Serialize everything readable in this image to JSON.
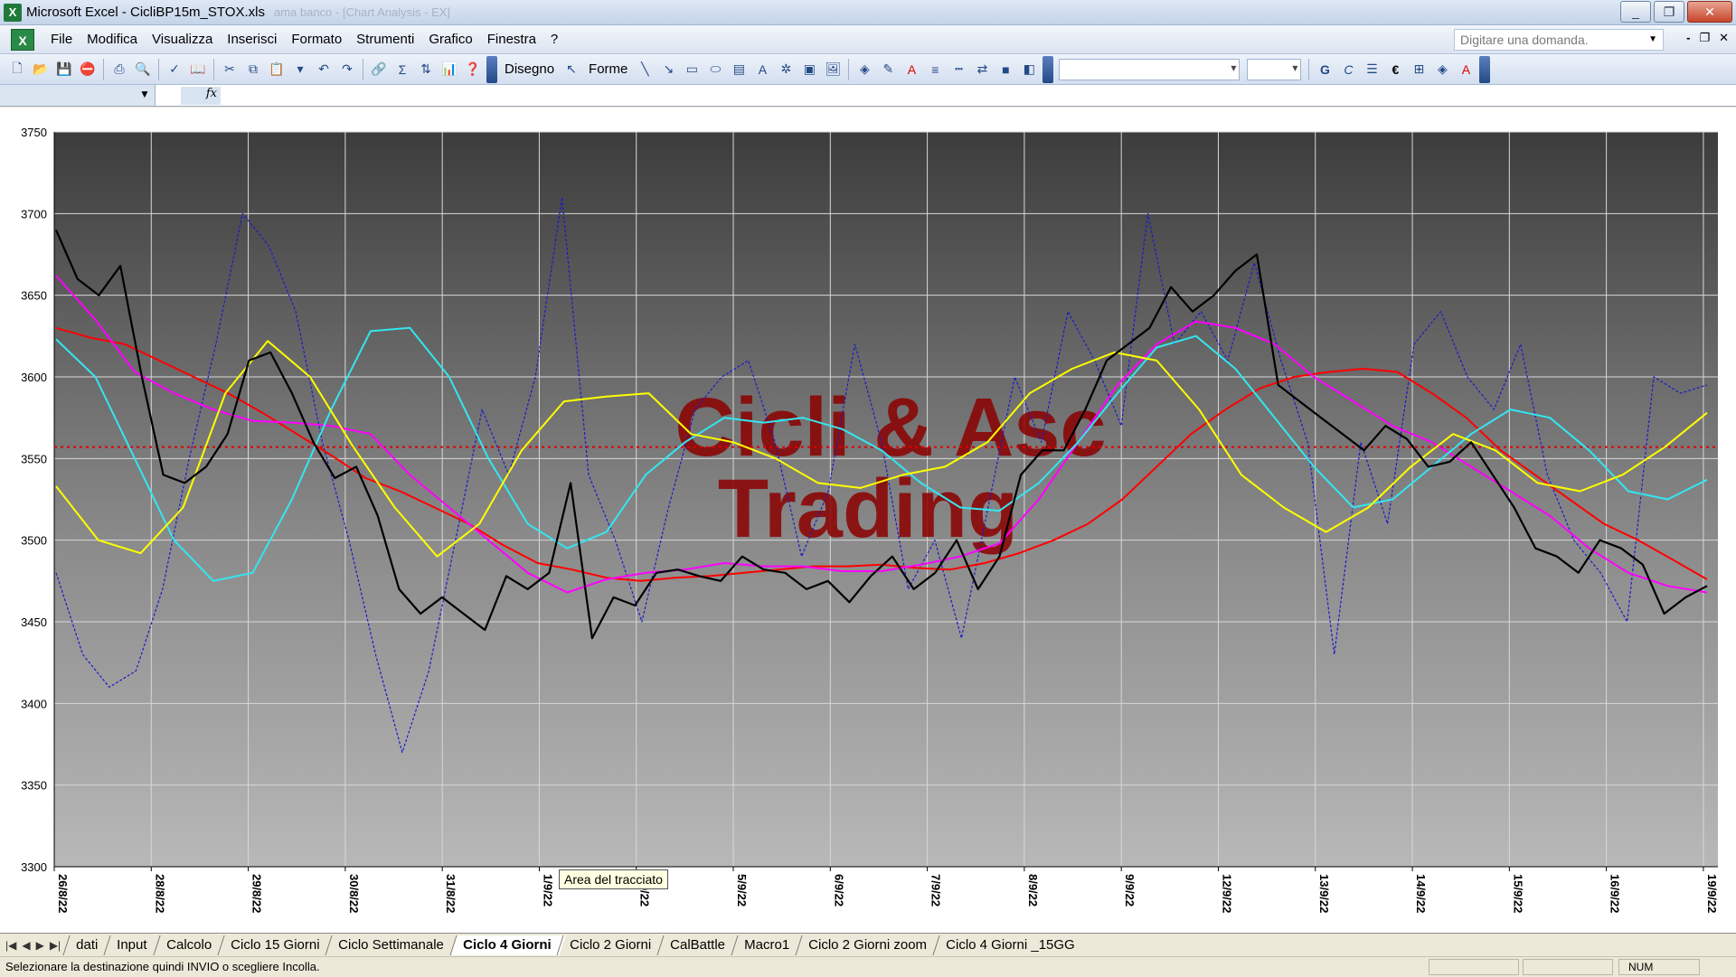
{
  "window": {
    "title": "Microsoft Excel - CicliBP15m_STOX.xls",
    "ghost_title": "ama banco - [Chart Analysis - EX]",
    "buttons": {
      "minimize": "_",
      "restore": "❐",
      "close": "✕"
    }
  },
  "menubar": {
    "items": [
      "File",
      "Modifica",
      "Visualizza",
      "Inserisci",
      "Formato",
      "Strumenti",
      "Grafico",
      "Finestra",
      "?"
    ],
    "ask_placeholder": "Digitare una domanda.",
    "doc_buttons": [
      "-",
      "❐",
      "✕"
    ]
  },
  "toolbar": {
    "draw_label": "Disegno",
    "shapes_label": "Forme",
    "bold": "G",
    "italic": "C",
    "euro": "€"
  },
  "tabs": {
    "items": [
      "dati",
      "Input",
      "Calcolo",
      "Ciclo 15 Giorni",
      "Ciclo Settimanale",
      "Ciclo 4 Giorni",
      "Ciclo 2 Giorni",
      "CalBattle",
      "Macro1",
      "Ciclo 2 Giorni zoom",
      "Ciclo 4 Giorni _15GG"
    ],
    "active": "Ciclo 4 Giorni"
  },
  "status": {
    "message": "Selezionare la destinazione quindi INVIO o scegliere Incolla.",
    "num": "NUM"
  },
  "tooltip": "Area del tracciato",
  "chart_data": {
    "type": "line",
    "watermark": [
      "Cicli & Asc",
      "Trading"
    ],
    "ylim": [
      3300,
      3750
    ],
    "yticks": [
      3300,
      3350,
      3400,
      3450,
      3500,
      3550,
      3600,
      3650,
      3700,
      3750
    ],
    "xtick_labels": [
      "26/8/22",
      "28/8/22",
      "29/8/22",
      "30/8/22",
      "31/8/22",
      "1/9/22",
      "2/9/22",
      "5/9/22",
      "6/9/22",
      "7/9/22",
      "8/9/22",
      "9/9/22",
      "12/9/22",
      "13/9/22",
      "14/9/22",
      "15/9/22",
      "16/9/22",
      "19/9/22"
    ],
    "hline": {
      "value": 3557,
      "color": "#e00000",
      "style": "dotted"
    },
    "grid": true,
    "colors": {
      "price": "#000000",
      "red": "#ff0000",
      "magenta": "#ff00ff",
      "cyan": "#33e6f0",
      "yellow": "#ffff00",
      "blue": "#1a1acc"
    },
    "series": [
      {
        "key": "price",
        "width": 2.2,
        "dash": "",
        "values": [
          3690,
          3660,
          3650,
          3668,
          3600,
          3540,
          3535,
          3545,
          3565,
          3610,
          3615,
          3590,
          3560,
          3538,
          3545,
          3515,
          3470,
          3455,
          3465,
          3455,
          3445,
          3478,
          3470,
          3480,
          3535,
          3440,
          3465,
          3460,
          3480,
          3482,
          3478,
          3475,
          3490,
          3482,
          3480,
          3470,
          3475,
          3462,
          3478,
          3490,
          3470,
          3480,
          3500,
          3470,
          3490,
          3540,
          3555,
          3555,
          3580,
          3610,
          3620,
          3630,
          3655,
          3640,
          3650,
          3665,
          3675,
          3595,
          3585,
          3575,
          3565,
          3555,
          3570,
          3562,
          3545,
          3548,
          3560,
          3540,
          3520,
          3495,
          3490,
          3480,
          3500,
          3495,
          3485,
          3455,
          3465,
          3472
        ]
      },
      {
        "key": "red",
        "width": 2,
        "dash": "",
        "values": [
          3630,
          3624,
          3620,
          3610,
          3600,
          3590,
          3578,
          3565,
          3552,
          3538,
          3530,
          3520,
          3510,
          3497,
          3486,
          3482,
          3477,
          3475,
          3477,
          3478,
          3480,
          3482,
          3484,
          3484,
          3485,
          3483,
          3482,
          3486,
          3492,
          3500,
          3510,
          3525,
          3545,
          3565,
          3580,
          3593,
          3600,
          3603,
          3605,
          3603,
          3590,
          3575,
          3555,
          3540,
          3525,
          3510,
          3500,
          3488,
          3476
        ]
      },
      {
        "key": "magenta",
        "width": 2,
        "dash": "",
        "values": [
          3662,
          3635,
          3603,
          3590,
          3580,
          3573,
          3572,
          3570,
          3565,
          3540,
          3520,
          3500,
          3480,
          3468,
          3476,
          3480,
          3482,
          3486,
          3484,
          3484,
          3481,
          3481,
          3485,
          3490,
          3498,
          3525,
          3560,
          3595,
          3620,
          3634,
          3630,
          3620,
          3600,
          3585,
          3570,
          3560,
          3545,
          3530,
          3515,
          3495,
          3480,
          3472,
          3468
        ]
      },
      {
        "key": "cyan",
        "width": 2,
        "dash": "",
        "values": [
          3623,
          3600,
          3550,
          3500,
          3475,
          3480,
          3525,
          3580,
          3628,
          3630,
          3600,
          3550,
          3510,
          3495,
          3505,
          3540,
          3560,
          3575,
          3572,
          3575,
          3568,
          3555,
          3535,
          3520,
          3518,
          3535,
          3560,
          3590,
          3618,
          3625,
          3605,
          3575,
          3545,
          3520,
          3525,
          3545,
          3565,
          3580,
          3575,
          3555,
          3530,
          3525,
          3537
        ]
      },
      {
        "key": "yellow",
        "width": 2,
        "dash": "",
        "values": [
          3533,
          3500,
          3492,
          3520,
          3590,
          3622,
          3600,
          3558,
          3520,
          3490,
          3510,
          3555,
          3585,
          3588,
          3590,
          3565,
          3560,
          3550,
          3535,
          3532,
          3540,
          3545,
          3560,
          3590,
          3605,
          3615,
          3610,
          3580,
          3540,
          3520,
          3505,
          3520,
          3545,
          3565,
          3555,
          3535,
          3530,
          3540,
          3557,
          3578
        ]
      },
      {
        "key": "blue",
        "width": 1.2,
        "dash": "3,2",
        "values": [
          3480,
          3430,
          3410,
          3420,
          3470,
          3550,
          3620,
          3700,
          3680,
          3640,
          3560,
          3500,
          3430,
          3370,
          3420,
          3500,
          3580,
          3540,
          3600,
          3710,
          3540,
          3500,
          3450,
          3520,
          3580,
          3600,
          3610,
          3560,
          3490,
          3530,
          3620,
          3560,
          3470,
          3500,
          3440,
          3520,
          3600,
          3560,
          3640,
          3610,
          3570,
          3700,
          3620,
          3640,
          3610,
          3670,
          3610,
          3560,
          3430,
          3560,
          3510,
          3620,
          3640,
          3600,
          3580,
          3620,
          3540,
          3500,
          3480,
          3450,
          3600,
          3590,
          3595
        ]
      }
    ]
  }
}
